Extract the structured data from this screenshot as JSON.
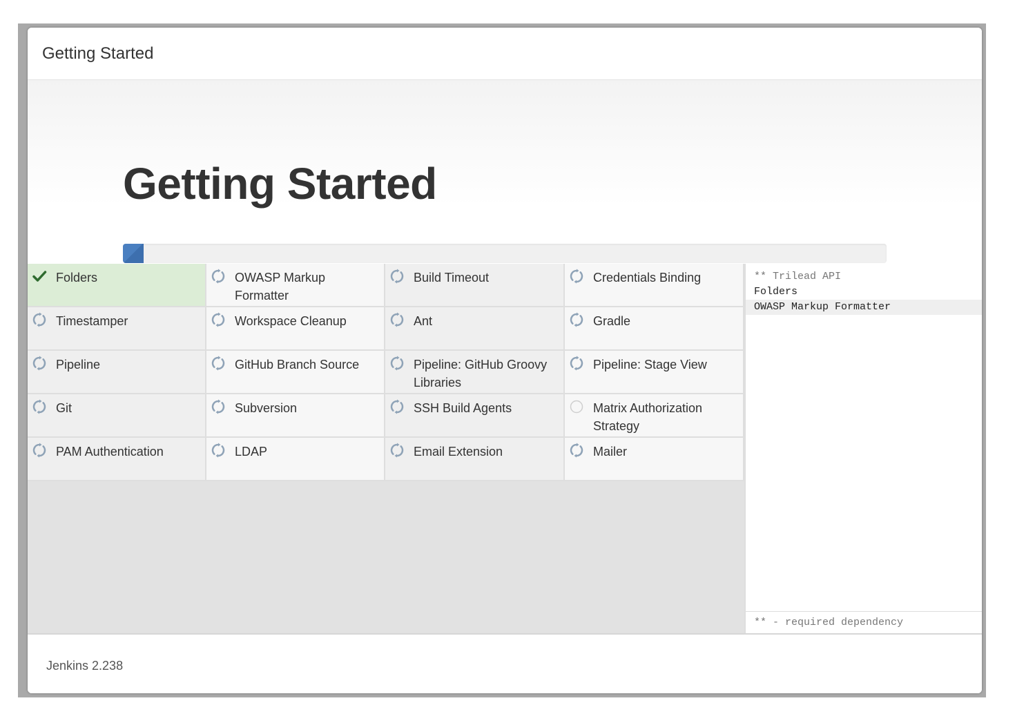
{
  "dialog": {
    "header_title": "Getting Started"
  },
  "hero": {
    "title": "Getting Started",
    "progress_fraction": 0.027
  },
  "colors": {
    "accent": "#4a7fc0",
    "done": "#dcedd6",
    "check": "#2f6b2f",
    "pending_icon": "#8fa3b7"
  },
  "plugins": [
    {
      "label": "Folders",
      "status": "done",
      "icon": "check-icon"
    },
    {
      "label": "OWASP Markup Formatter",
      "status": "installing",
      "icon": "refresh-icon"
    },
    {
      "label": "Build Timeout",
      "status": "installing",
      "icon": "refresh-icon"
    },
    {
      "label": "Credentials Binding",
      "status": "installing",
      "icon": "refresh-icon"
    },
    {
      "label": "Timestamper",
      "status": "installing",
      "icon": "refresh-icon"
    },
    {
      "label": "Workspace Cleanup",
      "status": "installing",
      "icon": "refresh-icon"
    },
    {
      "label": "Ant",
      "status": "installing",
      "icon": "refresh-icon"
    },
    {
      "label": "Gradle",
      "status": "installing",
      "icon": "refresh-icon"
    },
    {
      "label": "Pipeline",
      "status": "installing",
      "icon": "refresh-icon"
    },
    {
      "label": "GitHub Branch Source",
      "status": "installing",
      "icon": "refresh-icon"
    },
    {
      "label": "Pipeline: GitHub Groovy Libraries",
      "status": "installing",
      "icon": "refresh-icon"
    },
    {
      "label": "Pipeline: Stage View",
      "status": "installing",
      "icon": "refresh-icon"
    },
    {
      "label": "Git",
      "status": "installing",
      "icon": "refresh-icon"
    },
    {
      "label": "Subversion",
      "status": "installing",
      "icon": "refresh-icon"
    },
    {
      "label": "SSH Build Agents",
      "status": "installing",
      "icon": "refresh-icon"
    },
    {
      "label": "Matrix Authorization Strategy",
      "status": "pending",
      "icon": "circle-icon"
    },
    {
      "label": "PAM Authentication",
      "status": "installing",
      "icon": "refresh-icon"
    },
    {
      "label": "LDAP",
      "status": "installing",
      "icon": "refresh-icon"
    },
    {
      "label": "Email Extension",
      "status": "installing",
      "icon": "refresh-icon"
    },
    {
      "label": "Mailer",
      "status": "installing",
      "icon": "refresh-icon"
    }
  ],
  "log": {
    "lines": [
      "** Trilead API",
      "Folders",
      "OWASP Markup Formatter"
    ],
    "footer": "** - required dependency"
  },
  "footer": {
    "version": "Jenkins 2.238"
  }
}
